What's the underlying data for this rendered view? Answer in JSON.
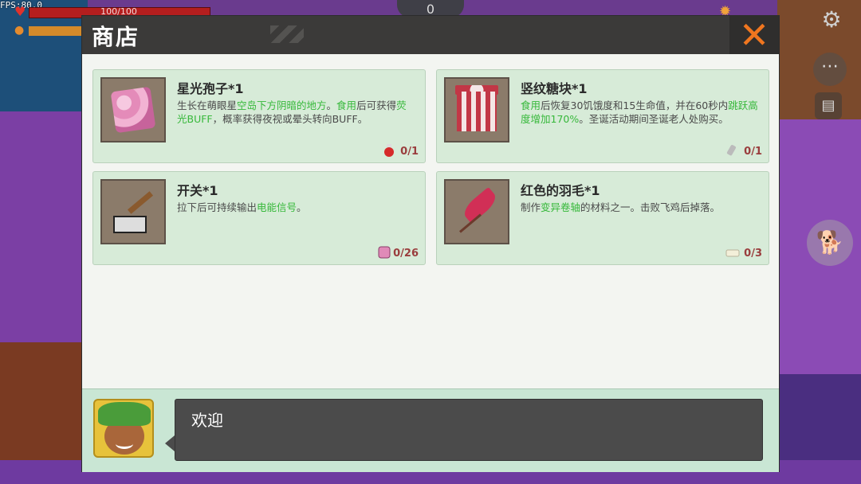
{
  "hud": {
    "fps": "FPS:80.0",
    "hp": "100/100",
    "top_counter": "0"
  },
  "shop": {
    "title": "商店",
    "close_icon": "close-x-icon",
    "items": [
      {
        "name": "星光孢子*1",
        "desc_parts": [
          {
            "t": "生长在萌眼星",
            "g": false
          },
          {
            "t": "空岛下方阴暗的地方",
            "g": true
          },
          {
            "t": "。",
            "g": false
          },
          {
            "t": "食用",
            "g": true
          },
          {
            "t": "后可获得",
            "g": false
          },
          {
            "t": "荧光BUFF",
            "g": true
          },
          {
            "t": "，概率获得夜视或晕头转向BUFF。",
            "g": false
          }
        ],
        "cost": "0/1",
        "cost_icon": "red-potion-icon",
        "icon": "star-spore-cube-icon"
      },
      {
        "name": "竖纹糖块*1",
        "desc_parts": [
          {
            "t": "食用",
            "g": true
          },
          {
            "t": "后恢复30饥饿度和15生命值，并在60秒内",
            "g": false
          },
          {
            "t": "跳跃高度增加170%",
            "g": true
          },
          {
            "t": "。圣诞活动期间圣诞老人处购买。",
            "g": false
          }
        ],
        "cost": "0/1",
        "cost_icon": "bottle-icon",
        "icon": "striped-candy-gift-icon"
      },
      {
        "name": "开关*1",
        "desc_parts": [
          {
            "t": "拉下后可持续输出",
            "g": false
          },
          {
            "t": "电能信号",
            "g": true
          },
          {
            "t": "。",
            "g": false
          }
        ],
        "cost": "0/26",
        "cost_icon": "pink-cube-icon",
        "icon": "lever-switch-icon"
      },
      {
        "name": "红色的羽毛*1",
        "desc_parts": [
          {
            "t": "制作",
            "g": false
          },
          {
            "t": "变异卷轴",
            "g": true
          },
          {
            "t": "的材料之一。击败飞鸡后掉落。",
            "g": false
          }
        ],
        "cost": "0/3",
        "cost_icon": "white-block-icon",
        "icon": "red-feather-icon"
      }
    ]
  },
  "dialog": {
    "text": "欢迎",
    "avatar": "npc-merchant-avatar"
  },
  "colors": {
    "card_bg": "#d7ebd8",
    "highlight_green": "#36b83a",
    "close_orange": "#f0761f",
    "header_dark": "#3b3a39"
  }
}
